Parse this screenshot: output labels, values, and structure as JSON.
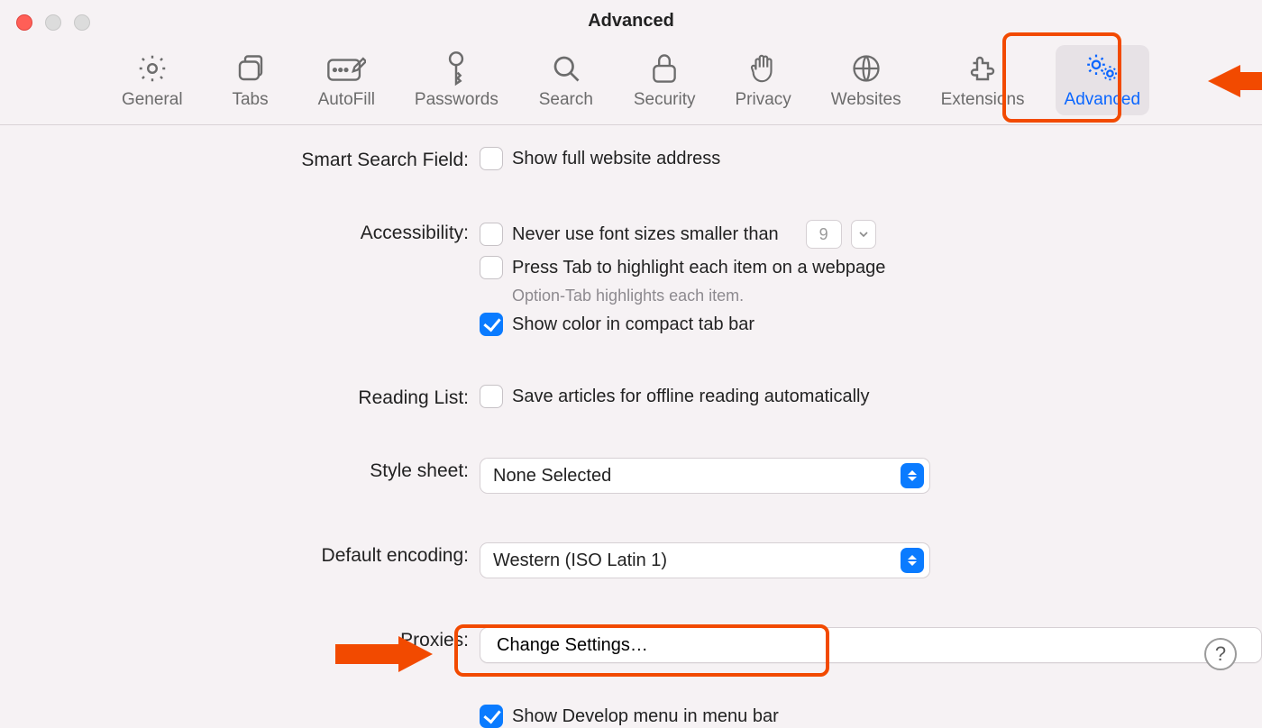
{
  "window": {
    "title": "Advanced"
  },
  "toolbar": {
    "items": [
      {
        "key": "general",
        "label": "General"
      },
      {
        "key": "tabs",
        "label": "Tabs"
      },
      {
        "key": "autofill",
        "label": "AutoFill"
      },
      {
        "key": "passwords",
        "label": "Passwords"
      },
      {
        "key": "search",
        "label": "Search"
      },
      {
        "key": "security",
        "label": "Security"
      },
      {
        "key": "privacy",
        "label": "Privacy"
      },
      {
        "key": "websites",
        "label": "Websites"
      },
      {
        "key": "extensions",
        "label": "Extensions"
      },
      {
        "key": "advanced",
        "label": "Advanced"
      }
    ],
    "active_key": "advanced"
  },
  "sections": {
    "smart_search": {
      "label": "Smart Search Field:",
      "show_full_address": {
        "label": "Show full website address",
        "checked": false
      }
    },
    "accessibility": {
      "label": "Accessibility:",
      "min_font": {
        "label": "Never use font sizes smaller than",
        "checked": false,
        "value": "9"
      },
      "press_tab": {
        "label": "Press Tab to highlight each item on a webpage",
        "checked": false
      },
      "press_tab_hint": "Option-Tab highlights each item.",
      "color_tab": {
        "label": "Show color in compact tab bar",
        "checked": true
      }
    },
    "reading_list": {
      "label": "Reading List:",
      "offline": {
        "label": "Save articles for offline reading automatically",
        "checked": false
      }
    },
    "style_sheet": {
      "label": "Style sheet:",
      "value": "None Selected"
    },
    "default_encoding": {
      "label": "Default encoding:",
      "value": "Western (ISO Latin 1)"
    },
    "proxies": {
      "label": "Proxies:",
      "button": "Change Settings…"
    },
    "develop": {
      "label": "Show Develop menu in menu bar",
      "checked": true
    }
  },
  "help_glyph": "?"
}
